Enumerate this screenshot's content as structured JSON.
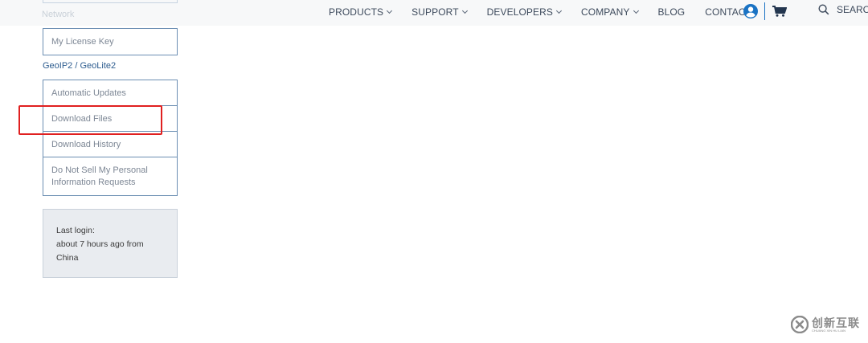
{
  "nav": {
    "items": [
      {
        "label": "PRODUCTS",
        "dropdown": true
      },
      {
        "label": "SUPPORT",
        "dropdown": true
      },
      {
        "label": "DEVELOPERS",
        "dropdown": true
      },
      {
        "label": "COMPANY",
        "dropdown": true
      },
      {
        "label": "BLOG",
        "dropdown": false
      },
      {
        "label": "CONTACT",
        "dropdown": false
      }
    ],
    "search_label": "SEARCH",
    "icons": [
      "user-icon",
      "cart-icon",
      "search-icon"
    ],
    "accent_color": "#1a73c4"
  },
  "sidebar": {
    "faded_top_label": "Network",
    "account_items": [
      {
        "label": "My License Key"
      }
    ],
    "section_heading": "GeoIP2 / GeoLite2",
    "geoip_items": [
      {
        "label": "Automatic Updates"
      },
      {
        "label": "Download Files"
      },
      {
        "label": "Download History"
      },
      {
        "label": "Do Not Sell My Personal Information Requests"
      }
    ],
    "login": {
      "line1": "Last login:",
      "line2": "about 7 hours ago from",
      "line3": "China"
    }
  },
  "annotation": {
    "highlight_color": "#e02020"
  },
  "watermark": {
    "text": "创新互联",
    "subtext": "CHUANG XIN HU LIAN"
  }
}
